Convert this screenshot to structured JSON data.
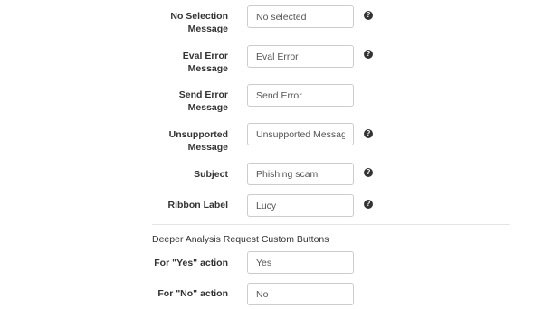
{
  "form": {
    "fields": [
      {
        "label_line1": "No Selection",
        "label_line2": "Message",
        "value": "No selected",
        "help": "?"
      },
      {
        "label_line1": "Eval Error",
        "label_line2": "Message",
        "value": "Eval Error",
        "help": "?"
      },
      {
        "label_line1": "Send Error",
        "label_line2": "Message",
        "value": "Send Error"
      },
      {
        "label_line1": "Unsupported",
        "label_line2": "Message",
        "value": "Unsupported Message",
        "help": "?"
      },
      {
        "label": "Subject",
        "value": "Phishing scam",
        "help": "?"
      },
      {
        "label": "Ribbon Label",
        "value": "Lucy",
        "help": "?"
      }
    ]
  },
  "section": {
    "title": "Deeper Analysis Request Custom Buttons",
    "fields": [
      {
        "label": "For \"Yes\" action",
        "value": "Yes"
      },
      {
        "label": "For \"No\" action",
        "value": "No"
      }
    ]
  }
}
